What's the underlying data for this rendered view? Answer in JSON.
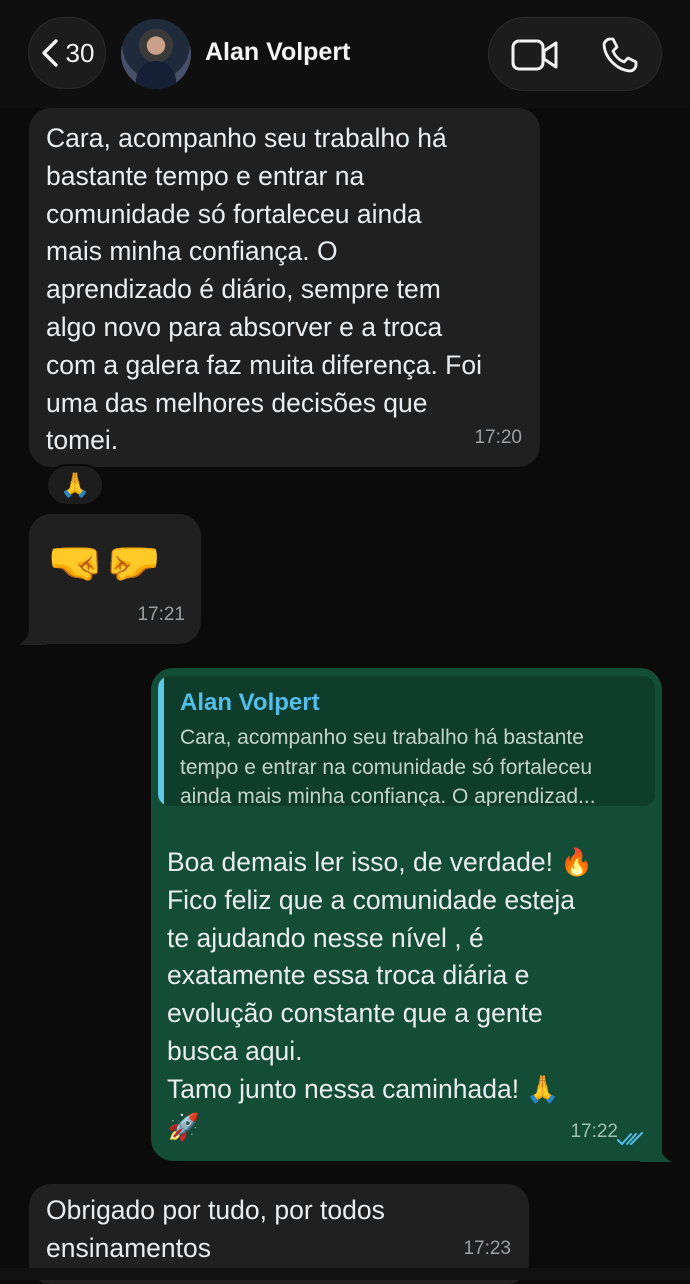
{
  "header": {
    "back_count": "30",
    "contact_name": "Alan Volpert",
    "icons": {
      "back": "chevron-left-icon",
      "video": "video-camera-icon",
      "call": "phone-icon"
    }
  },
  "messages": [
    {
      "direction": "incoming",
      "text": "Cara, acompanho seu trabalho há\nbastante tempo e entrar na\ncomunidade só fortaleceu ainda\nmais minha confiança. O\naprendizado é diário, sempre tem\nalgo novo para absorver e a troca\ncom a galera faz muita diferença. Foi\numa das melhores decisões que\ntomei.",
      "time": "17:20",
      "reaction": "🙏"
    },
    {
      "direction": "incoming",
      "text": "🤜🤛",
      "time": "17:21"
    },
    {
      "direction": "outgoing",
      "quote_author": "Alan Volpert",
      "quote_text": "Cara, acompanho seu trabalho há bastante\ntempo e entrar na comunidade só fortaleceu\nainda mais minha confiança. O aprendizad...",
      "text": "Boa demais ler isso, de verdade! 🔥\nFico feliz que a comunidade esteja\nte ajudando nesse nível , é\nexatamente essa troca diária e\nevolução constante que a gente\nbusca aqui.\nTamo junto nessa caminhada!  🙏\n🚀",
      "time": "17:22",
      "status": "read"
    },
    {
      "direction": "incoming",
      "text": "Obrigado por tudo, por todos\nensinamentos",
      "time": "17:23"
    }
  ],
  "colors": {
    "background": "#0b0b0b",
    "incoming_bubble": "#202020",
    "outgoing_bubble": "#144d37",
    "quote_accent": "#5cc8e6",
    "read_ticks": "#53bdeb"
  }
}
